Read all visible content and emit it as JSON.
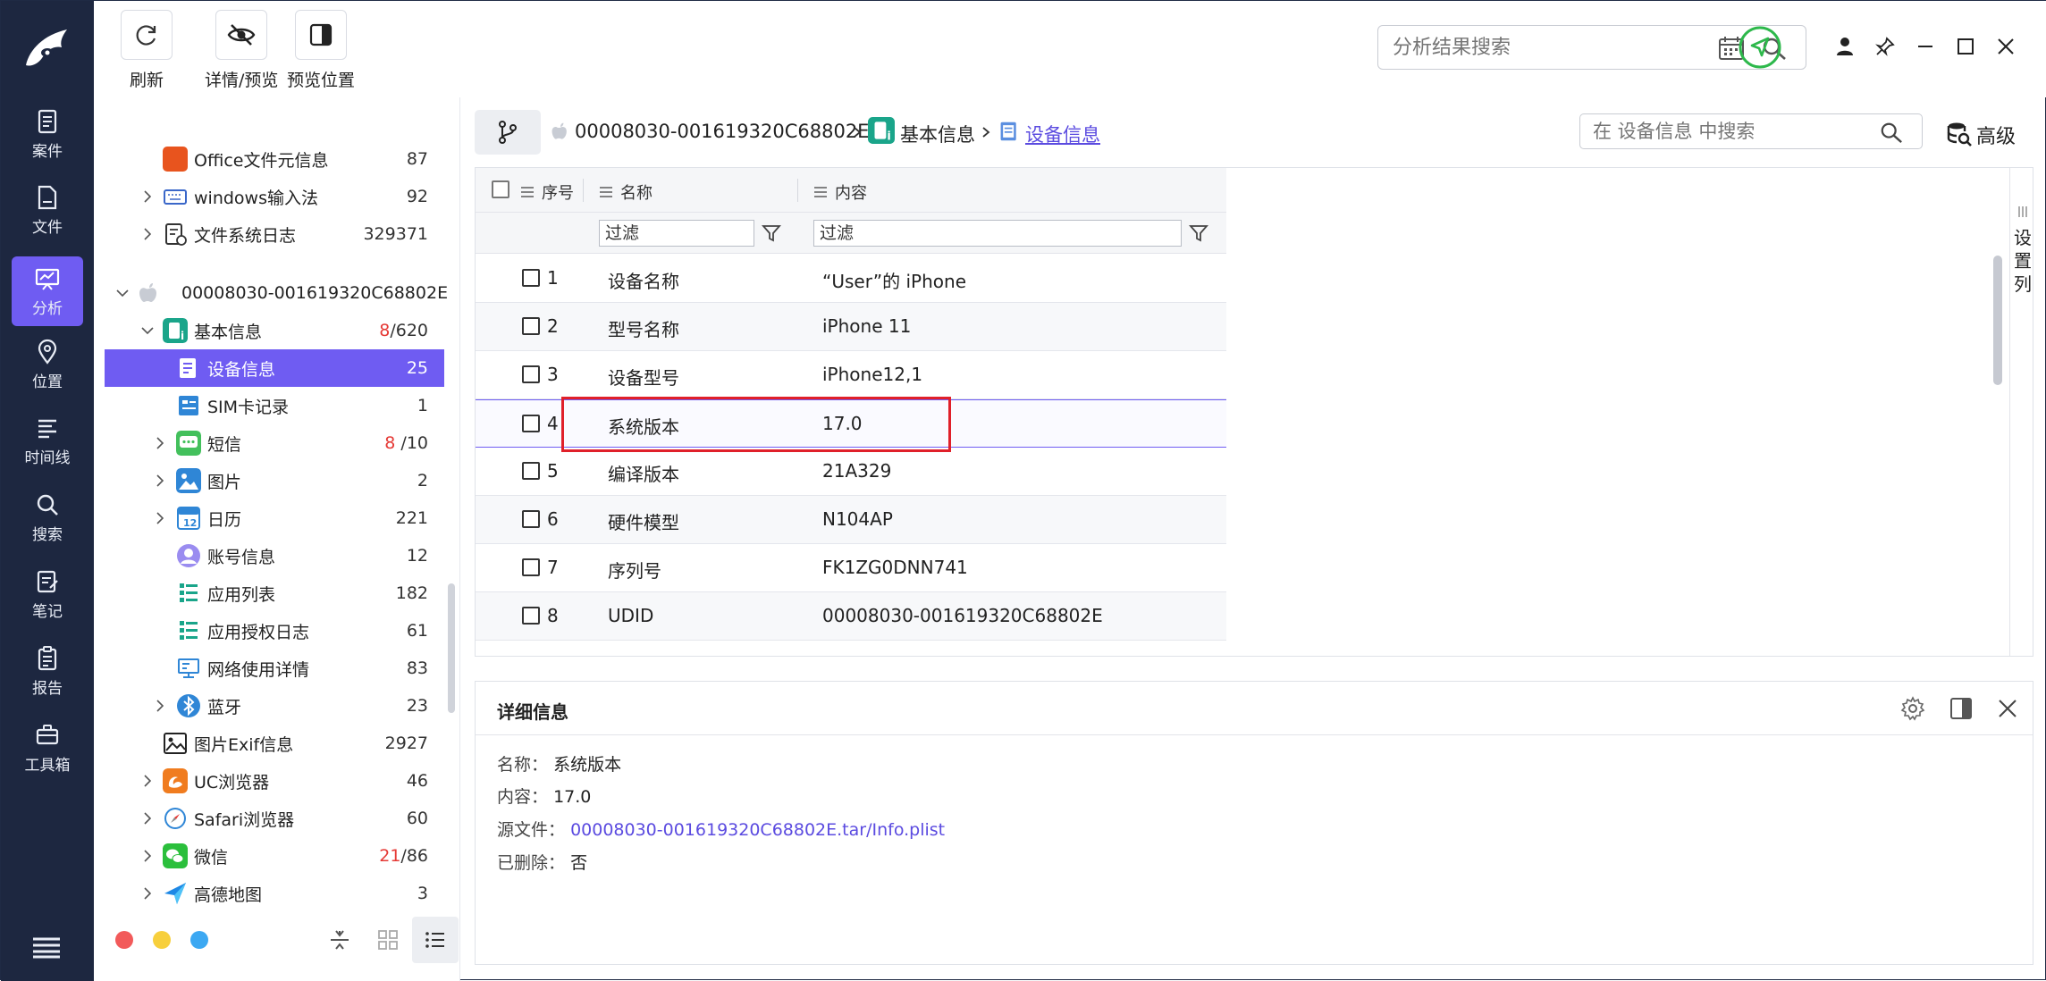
{
  "toolbar": {
    "refresh_label": "刷新",
    "detail_preview_label": "详情/预览",
    "preview_position_label": "预览位置",
    "search_placeholder": "分析结果搜索"
  },
  "rail": {
    "items": [
      {
        "label": "案件",
        "icon": "case-icon"
      },
      {
        "label": "文件",
        "icon": "file-icon"
      },
      {
        "label": "分析",
        "icon": "analysis-icon",
        "active": true
      },
      {
        "label": "位置",
        "icon": "location-icon"
      },
      {
        "label": "时间线",
        "icon": "timeline-icon"
      },
      {
        "label": "搜索",
        "icon": "search-icon"
      },
      {
        "label": "笔记",
        "icon": "note-icon"
      },
      {
        "label": "报告",
        "icon": "report-icon"
      },
      {
        "label": "工具箱",
        "icon": "toolbox-icon"
      }
    ]
  },
  "tree": {
    "items": [
      {
        "label": "Office文件元信息",
        "count": "87"
      },
      {
        "label": "windows输入法",
        "count": "92"
      },
      {
        "label": "文件系统日志",
        "count": "329371"
      },
      {
        "label": "00008030-001619320C68802E",
        "count": ""
      },
      {
        "label": "基本信息",
        "count_red": "8",
        "count": "/620"
      },
      {
        "label": "设备信息",
        "count": "25"
      },
      {
        "label": "SIM卡记录",
        "count": "1"
      },
      {
        "label": "短信",
        "count_red": "8",
        "count": " /10"
      },
      {
        "label": "图片",
        "count": "2"
      },
      {
        "label": "日历",
        "count": "221"
      },
      {
        "label": "账号信息",
        "count": "12"
      },
      {
        "label": "应用列表",
        "count": "182"
      },
      {
        "label": "应用授权日志",
        "count": "61"
      },
      {
        "label": "网络使用详情",
        "count": "83"
      },
      {
        "label": "蓝牙",
        "count": "23"
      },
      {
        "label": "图片Exif信息",
        "count": "2927"
      },
      {
        "label": "UC浏览器",
        "count": "46"
      },
      {
        "label": "Safari浏览器",
        "count": "60"
      },
      {
        "label": "微信",
        "count_red": "21",
        "count": "/86"
      },
      {
        "label": "高德地图",
        "count": "3"
      }
    ],
    "calendar_icon_text": "12"
  },
  "breadcrumb": {
    "device": "00008030-001619320C68802E",
    "basic": "基本信息",
    "current": "设备信息",
    "search_placeholder": "在 设备信息 中搜索",
    "advanced_label": "高级"
  },
  "grid": {
    "columns": {
      "index": "序号",
      "name": "名称",
      "content": "内容"
    },
    "filter_name": "过滤",
    "filter_content": "过滤",
    "set_columns_label": [
      "设",
      "置",
      "列"
    ],
    "rows": [
      {
        "index": "1",
        "name": "设备名称",
        "value": "“User”的 iPhone"
      },
      {
        "index": "2",
        "name": "型号名称",
        "value": "iPhone 11"
      },
      {
        "index": "3",
        "name": "设备型号",
        "value": "iPhone12,1"
      },
      {
        "index": "4",
        "name": "系统版本",
        "value": "17.0"
      },
      {
        "index": "5",
        "name": "编译版本",
        "value": "21A329"
      },
      {
        "index": "6",
        "name": "硬件模型",
        "value": "N104AP"
      },
      {
        "index": "7",
        "name": "序列号",
        "value": "FK1ZG0DNN741"
      },
      {
        "index": "8",
        "name": "UDID",
        "value": "00008030-001619320C68802E"
      }
    ]
  },
  "detail": {
    "title": "详细信息",
    "name_key": "名称：",
    "name_val": "系统版本",
    "content_key": "内容：",
    "content_val": "17.0",
    "source_key": "源文件：",
    "source_val": "00008030-001619320C68802E.tar/Info.plist",
    "deleted_key": "已删除：",
    "deleted_val": "否"
  },
  "colors": {
    "accent": "#6f5cf2",
    "rail_bg": "#1d2740",
    "highlight_red": "#e0202a",
    "status_green": "#2db84b"
  }
}
